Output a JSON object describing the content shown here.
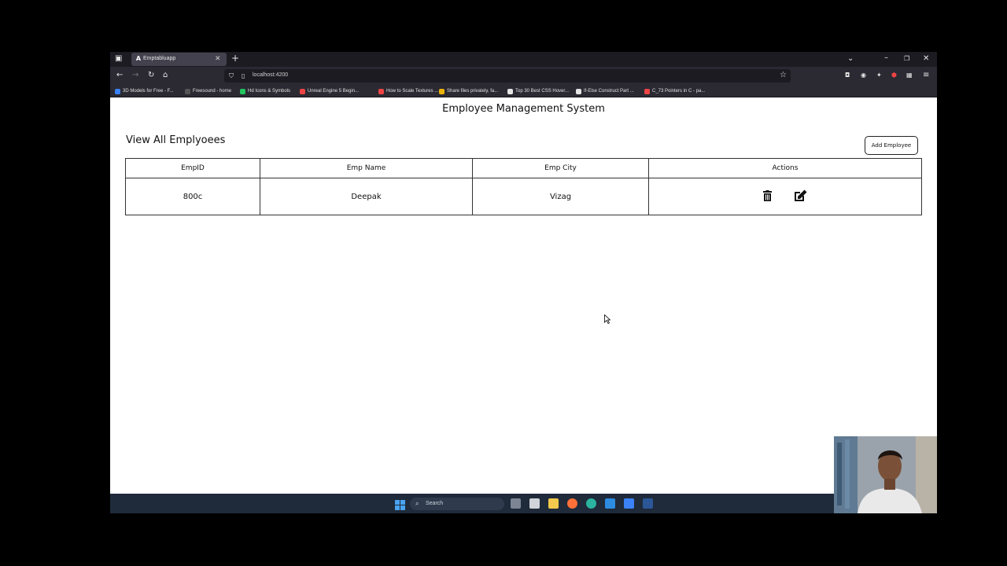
{
  "browser": {
    "tab_title": "Emptabluapp",
    "tab_favicon": "A",
    "url": "localhost:4200",
    "bookmarks": [
      {
        "label": "3D Models for Free - F...",
        "color": "#3b82f6"
      },
      {
        "label": "Freesound - home",
        "color": "#555555"
      },
      {
        "label": "Hd Icons & Symbols",
        "color": "#22c55e"
      },
      {
        "label": "Unreal Engine 5 Begin...",
        "color": "#ef4444"
      },
      {
        "label": "How to Scale Textures ...",
        "color": "#ef4444"
      },
      {
        "label": "Share files privately, fa...",
        "color": "#eab308"
      },
      {
        "label": "Top 30 Best CSS Hover...",
        "color": "#e5e5e5"
      },
      {
        "label": "If-Else Construct Part ...",
        "color": "#e5e5e5"
      },
      {
        "label": "C_73 Pointers in C - pa...",
        "color": "#ef4444"
      }
    ]
  },
  "page": {
    "app_title": "Employee Management System",
    "section_title": "View All Emplyoees",
    "add_button_label": "Add Employee",
    "table": {
      "headers": [
        "EmpID",
        "Emp Name",
        "Emp City",
        "Actions"
      ],
      "rows": [
        {
          "id": "800c",
          "name": "Deepak",
          "city": "Vizag"
        }
      ]
    }
  },
  "taskbar": {
    "search_placeholder": "Search"
  }
}
